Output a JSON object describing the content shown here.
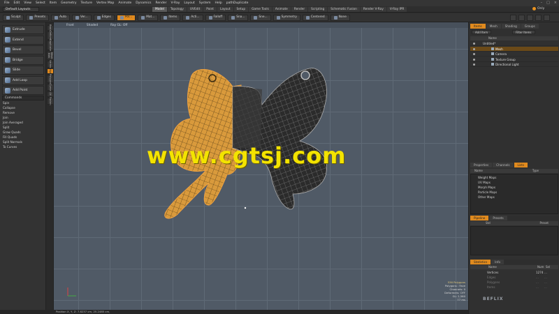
{
  "menubar": {
    "items": [
      "File",
      "Edit",
      "View",
      "Select",
      "Item",
      "Geometry",
      "Texture",
      "Vertex Map",
      "Animate",
      "Dynamics",
      "Render",
      "V-Ray",
      "Layout",
      "System",
      "Help",
      "pathDuplicate"
    ]
  },
  "layoutbar": {
    "layout_select": "Default Layouts",
    "tabs": [
      "Model",
      "Topology",
      "UVEdit",
      "Paint",
      "Layout",
      "Setup",
      "Game Tools",
      "Animate",
      "Render",
      "Scripting",
      "Schematic Fusion",
      "Render V-Ray",
      "V-Ray IPR"
    ],
    "active_tab": "Model",
    "only_label": "Only"
  },
  "toolbar": {
    "buttons": [
      "Sculpt",
      "Presets",
      "Auto",
      "Ver...",
      "Edges",
      "Pol...",
      "Mat...",
      "Items",
      "Acti...",
      "Falloff",
      "Sna...",
      "Sne...",
      "Symmetry",
      "Centered",
      "None"
    ]
  },
  "left_tools": {
    "tools": [
      "Extrude",
      "Extend",
      "Bevel",
      "Bridge",
      "Slide",
      "Add Loop",
      "Add Point"
    ],
    "commands_header": "Commands",
    "commands": [
      "Spin",
      "Collapse",
      "Remove",
      "Join",
      "Join Averaged",
      "Split",
      "Grow Quads",
      "Fill Quads",
      "Split Normals",
      "To Curves"
    ],
    "vertical_tabs": [
      "Basic",
      "Deform",
      "Duplicate",
      "Mesh Edit",
      "Vertex",
      "Edge",
      "Polygon",
      "Curve",
      "UV",
      "Fusion"
    ],
    "active_vertical_tab": "Edge"
  },
  "viewport": {
    "header": [
      "Front",
      "Shaded",
      "Ray GL: Off"
    ],
    "info_lines": [
      "536 Polygons",
      "Polygons : Face",
      "Channels: 0",
      "Deformers: OFF",
      "GL: 2,560",
      "77 ms"
    ],
    "watermark": "www.cgtsj.com"
  },
  "status": {
    "position": "Position X, Y, Z:   7.8237 cm, 25.2485 cm,"
  },
  "right_panel": {
    "top_tabs": [
      "Items",
      "Mesh",
      "Shading",
      "Groups"
    ],
    "active_top_tab": "Items",
    "add_item": "Add Item",
    "filter_items": "Filter Items",
    "name_col": "Name",
    "tree": [
      {
        "label": "Untitled*",
        "level": 0,
        "selected": false
      },
      {
        "label": "Mesh",
        "level": 1,
        "selected": true
      },
      {
        "label": "Camera",
        "level": 1,
        "selected": false
      },
      {
        "label": "Texture Group",
        "level": 1,
        "selected": false
      },
      {
        "label": "Directional Light",
        "level": 1,
        "selected": false
      }
    ],
    "mid_tabs": [
      "Properties",
      "Channels",
      "Lists"
    ],
    "active_mid_tab": "Lists",
    "list_cols": [
      "Name",
      "Type"
    ],
    "list_items": [
      "Weight Maps",
      "UV Maps",
      "Morph Maps",
      "Particle Maps",
      "Other Maps"
    ],
    "pipeline_tabs": [
      "Pipeline",
      "Presets"
    ],
    "pipeline_cols": [
      "Std",
      "Preset"
    ],
    "stats_tabs": [
      "Statistics",
      "Info"
    ],
    "stats_cols": [
      "Name",
      "Num",
      "Sel"
    ],
    "stats_rows": [
      {
        "name": "Vertices",
        "num": "1274",
        "sel": "..."
      },
      {
        "name": "Edges",
        "num": "...",
        "sel": "..."
      },
      {
        "name": "Polygons",
        "num": "...",
        "sel": "..."
      },
      {
        "name": "Items",
        "num": "...",
        "sel": "..."
      }
    ]
  },
  "colors": {
    "accent": "#e08a1e",
    "viewport_bg": "#505a66",
    "mesh_left": "#d99a3c",
    "mesh_right": "#2e2e2e",
    "watermark": "#f3e300"
  },
  "icons": [
    "mesh-icon",
    "camera-icon",
    "light-icon",
    "texture-icon",
    "eye-icon"
  ]
}
